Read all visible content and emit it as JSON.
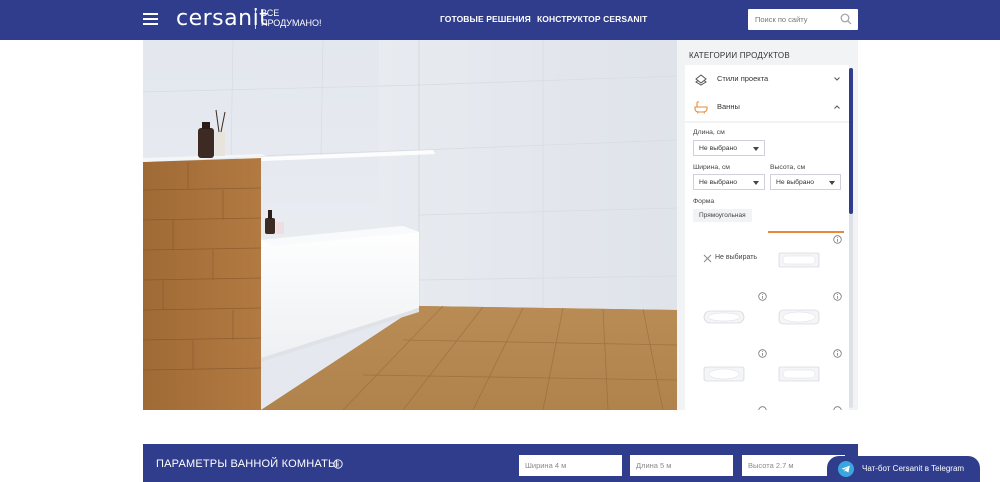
{
  "header": {
    "logo": "cersanit",
    "slogan_line1": "ВСЕ",
    "slogan_line2": "ПРОДУМАНО!",
    "nav": [
      {
        "label": "ГОТОВЫЕ РЕШЕНИЯ"
      },
      {
        "label": "КОНСТРУКТОР CERSANIT"
      }
    ],
    "search_placeholder": "Поиск по сайту"
  },
  "panel": {
    "title": "КАТЕГОРИИ ПРОДУКТОВ",
    "categories": [
      {
        "label": "Стили проекта",
        "icon": "styles-icon",
        "expanded": false
      },
      {
        "label": "Ванны",
        "icon": "bathtub-icon",
        "expanded": true
      }
    ],
    "filters": {
      "length_label": "Длина, см",
      "length_value": "Не выбрано",
      "width_label": "Ширина, см",
      "width_value": "Не выбрано",
      "height_label": "Высота, см",
      "height_value": "Не выбрано",
      "shape_label": "Форма",
      "shape_chip": "Прямоугольная"
    },
    "none_option": "Не выбирать",
    "accent_color": "#e8893a"
  },
  "params": {
    "title": "ПАРАМЕТРЫ ВАННОЙ КОМНАТЫ",
    "width_placeholder": "Ширина 4 м",
    "length_placeholder": "Длина 5 м",
    "height_placeholder": "Высота 2.7 м"
  },
  "chat": {
    "label": "Чат-бот Cersanit в Telegram"
  },
  "colors": {
    "brand": "#2f3d8c",
    "accent": "#e8893a"
  }
}
